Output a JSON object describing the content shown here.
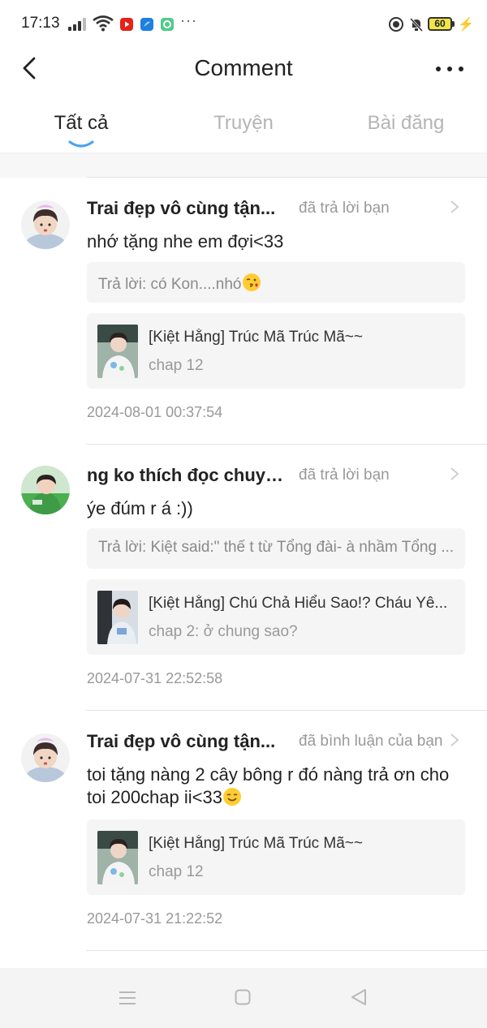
{
  "status_bar": {
    "time": "17:13",
    "battery": "60",
    "more": "···"
  },
  "header": {
    "title": "Comment",
    "back_icon": "chevron-left-icon",
    "more_icon": "more-horizontal-icon"
  },
  "tabs": [
    {
      "label": "Tất cả",
      "active": true
    },
    {
      "label": "Truyện",
      "active": false
    },
    {
      "label": "Bài đăng",
      "active": false
    }
  ],
  "comments": [
    {
      "username": "Trai đẹp vô cùng tận...",
      "action": "đã trả lời bạn",
      "text": "nhớ tặng nhe em đợi<33",
      "reply": "Trả lời: có Kon....nhó",
      "reply_emoji": "kissing-face-emoji",
      "story_title": "[Kiệt Hằng] Trúc Mã Trúc Mã~~",
      "story_chapter": "chap 12",
      "timestamp": "2024-08-01 00:37:54"
    },
    {
      "username": "ng ko thích đọc chuyệ...",
      "action": "đã trả lời bạn",
      "text": "ýe đúm r á :))",
      "reply": "Trả lời: Kiệt said:\" thế t từ Tổng đài- à nhầm Tổng ...",
      "story_title": "[Kiệt Hằng] Chú Chả Hiểu Sao!? Cháu Yê...",
      "story_chapter": "chap 2: ở chung sao?",
      "timestamp": "2024-07-31 22:52:58"
    },
    {
      "username": "Trai đẹp vô cùng tận...",
      "action": "đã bình luận của bạn",
      "text": "toi tặng nàng 2 cây bông r đó nàng trả ơn cho toi 200chap ii<33",
      "text_emoji": "smiling-face-emoji",
      "story_title": "[Kiệt Hằng] Trúc Mã Trúc Mã~~",
      "story_chapter": "chap 12",
      "timestamp": "2024-07-31 21:22:52"
    }
  ],
  "nav_bar": {
    "menu_icon": "menu-icon",
    "home_icon": "home-square-icon",
    "back_icon": "back-triangle-icon"
  },
  "colors": {
    "tab_indicator": "#4aa3f0",
    "muted_text": "#999999",
    "card_bg": "#f5f5f5"
  }
}
